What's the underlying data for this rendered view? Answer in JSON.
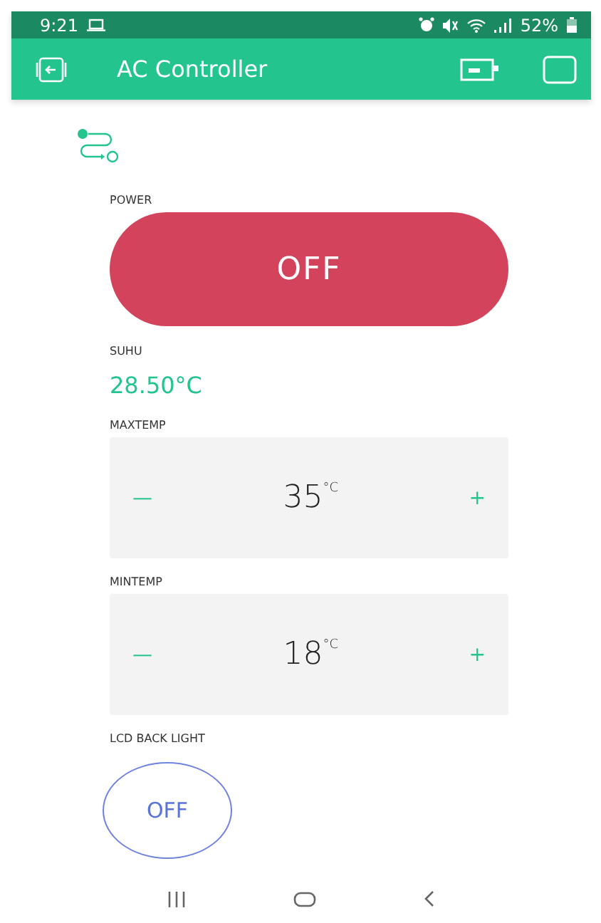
{
  "status_bar": {
    "time": "9:21",
    "battery": "52%"
  },
  "app_bar": {
    "title": "AC Controller"
  },
  "power": {
    "label": "POWER",
    "text": "OFF",
    "on": false
  },
  "temperature": {
    "label": "SUHU",
    "value": "28.50°C"
  },
  "steppers": [
    {
      "label": "MAXTEMP",
      "minus": "—",
      "value": "35",
      "unit": "°C",
      "plus": "+"
    },
    {
      "label": "MINTEMP",
      "minus": "—",
      "value": "18",
      "unit": "°C",
      "plus": "+"
    }
  ],
  "backlight": {
    "label": "LCD BACK LIGHT",
    "text": "OFF",
    "on": false
  }
}
